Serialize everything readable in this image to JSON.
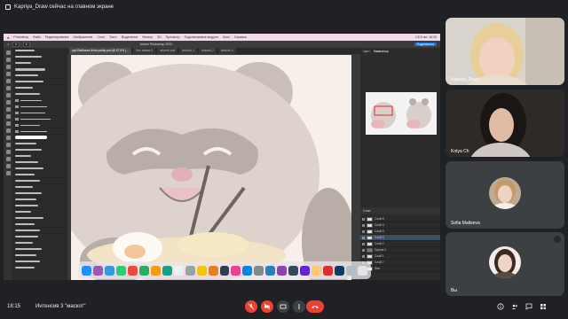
{
  "banner": {
    "text": "Kapriya_Draw сейчас на главном экране"
  },
  "photoshop": {
    "menubar": {
      "items": [
        "Photoshop",
        "Файл",
        "Редактирование",
        "Изображение",
        "Слои",
        "Текст",
        "Выделение",
        "Фильтр",
        "3D",
        "Просмотр",
        "Подключаемые модули",
        "Окно",
        "Справка"
      ],
      "right": "Сб 5 окт. 16:39"
    },
    "options": {
      "app_title": "Adobe Photoshop 2022",
      "share": "Поделиться"
    },
    "tabs": [
      "ppd Ballbama Alma paddy psd @ 67,5% (…",
      "Без имени-1",
      "artwork.psd",
      "artwork-1",
      "artwork-2",
      "artwork-3"
    ],
    "right_tabs": [
      "Цвет",
      "Навигатор"
    ],
    "layers": {
      "header": "Слои",
      "items": [
        "Слой 6",
        "Слой 4",
        "Слой 5",
        "Слой 3",
        "Слой 2",
        "Группа 1",
        "Слой 1",
        "Слой 7",
        "Фон"
      ]
    }
  },
  "participants": [
    {
      "name": "Kapriya_Draw"
    },
    {
      "name": "Kotya Ch"
    },
    {
      "name": "Sofia Maltseva"
    },
    {
      "name": "Вы"
    }
  ],
  "bottom": {
    "time": "18:15",
    "meeting_name": "Интенсив 3 \"маскот\""
  },
  "colors": {
    "accent": "#1a73e8",
    "danger": "#ea4335",
    "bg": "#202124",
    "tile": "#3c4043"
  },
  "icons": [
    "mic-off-icon",
    "camera-off-icon",
    "present-icon",
    "more-icon",
    "end-call-icon",
    "info-icon",
    "people-icon",
    "chat-icon",
    "activities-icon"
  ]
}
